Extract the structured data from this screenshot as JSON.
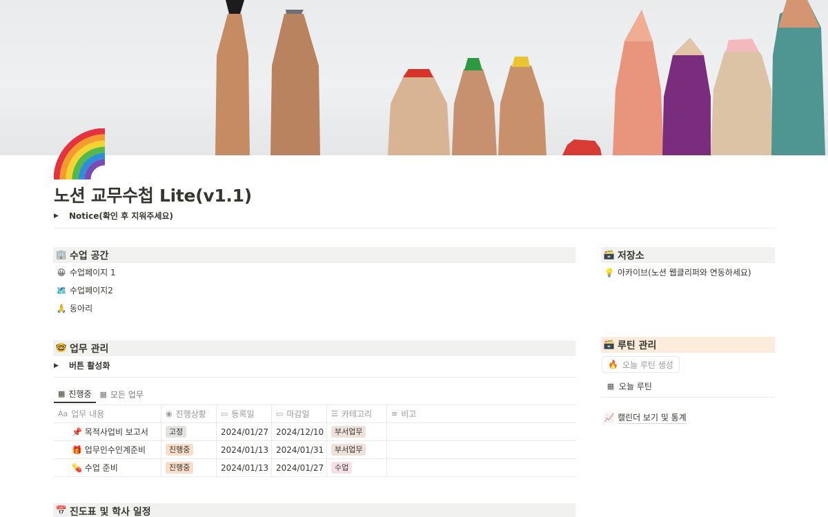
{
  "page": {
    "title": "노션 교무수첩 Lite(v1.1)",
    "icon": "rainbow-icon",
    "notice_toggle": "Notice(확인 후 지워주세요)"
  },
  "class_space": {
    "icon": "office-building-icon",
    "title": "수업 공간",
    "links": [
      {
        "icon": "smiley-face-icon",
        "emoji": "😀",
        "label": "수업페이지 1"
      },
      {
        "icon": "map-icon",
        "emoji": "🗺️",
        "label": "수업페이지2"
      },
      {
        "icon": "folded-hands-icon",
        "emoji": "🙏",
        "label": "동아리"
      }
    ]
  },
  "storage": {
    "icon": "card-file-box-icon",
    "title": "저장소",
    "links": [
      {
        "icon": "lightbulb-icon",
        "emoji": "💡",
        "label": "아카이브(노션 웹클리퍼와 연동하세요)"
      }
    ]
  },
  "work": {
    "icon": "nerd-face-icon",
    "title": "업무 관리",
    "toggle": "버튼 활성화",
    "tabs": [
      {
        "label": "진행중",
        "active": true
      },
      {
        "label": "모든 업무",
        "active": false
      }
    ],
    "columns": [
      "업무 내용",
      "진행상황",
      "등록일",
      "마감일",
      "카테고리",
      "비고"
    ],
    "rows": [
      {
        "emoji": "📌",
        "name": "목적사업비 보고서",
        "status": "고정",
        "registered": "2024/01/27",
        "due": "2024/12/10",
        "category": "부서업무",
        "note": ""
      },
      {
        "emoji": "🎁",
        "name": "업무인수인계준비",
        "status": "진행중",
        "registered": "2024/01/13",
        "due": "2024/01/31",
        "category": "부서업무",
        "note": ""
      },
      {
        "emoji": "💊",
        "name": "수업 준비",
        "status": "진행중",
        "registered": "2024/01/13",
        "due": "2024/01/27",
        "category": "수업",
        "note": ""
      }
    ]
  },
  "routine": {
    "icon": "card-file-box-icon",
    "title": "루틴 관리",
    "button": "오늘 루틴 생성",
    "button_icon": "fire-icon",
    "today": "오늘 루틴",
    "calendar": "캘린더 보기 및 통계"
  },
  "schedule": {
    "icon": "calendar-icon",
    "title": "진도표 및 학사 일정"
  },
  "colors": {
    "tag_gray": "#e3e2e0",
    "tag_orange": "#fadec9",
    "tag_brown": "#eee0da",
    "tag_pink": "#f5e0e9",
    "header_gray": "#f1f1ef",
    "header_peach": "#fbecdd"
  }
}
